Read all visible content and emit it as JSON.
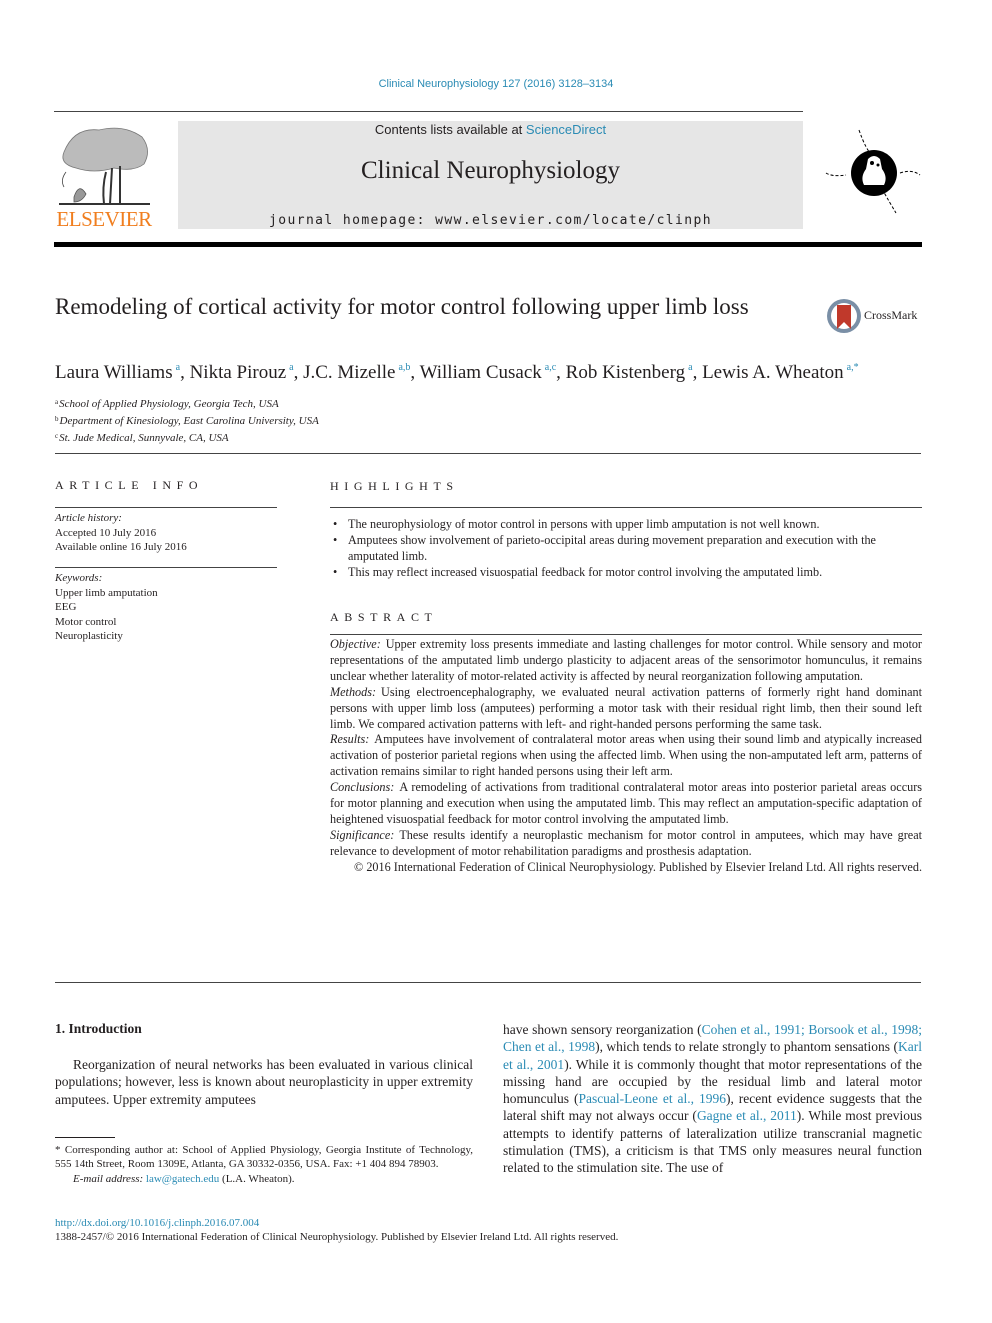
{
  "header": {
    "journal_citation": "Clinical Neurophysiology 127 (2016) 3128–3134",
    "contents_prefix": "Contents lists available at ",
    "contents_link": "ScienceDirect",
    "journal_name": "Clinical Neurophysiology",
    "homepage_prefix": "journal homepage: ",
    "homepage_url": "www.elsevier.com/locate/clinph",
    "publisher_logo_text": "ELSEVIER",
    "publisher_color": "#f07e1f",
    "link_color": "#2a8bb4"
  },
  "article": {
    "title": "Remodeling of cortical activity for motor control following upper limb loss",
    "crossmark_label": "CrossMark",
    "authors": [
      {
        "name": "Laura Williams",
        "affil": "a"
      },
      {
        "name": "Nikta Pirouz",
        "affil": "a"
      },
      {
        "name": "J.C. Mizelle",
        "affil": "a,b"
      },
      {
        "name": "William Cusack",
        "affil": "a,c"
      },
      {
        "name": "Rob Kistenberg",
        "affil": "a"
      },
      {
        "name": "Lewis A. Wheaton",
        "affil": "a,*"
      }
    ],
    "affiliations": [
      {
        "key": "a",
        "text": "School of Applied Physiology, Georgia Tech, USA"
      },
      {
        "key": "b",
        "text": "Department of Kinesiology, East Carolina University, USA"
      },
      {
        "key": "c",
        "text": "St. Jude Medical, Sunnyvale, CA, USA"
      }
    ]
  },
  "article_info": {
    "heading": "ARTICLE INFO",
    "history_label": "Article history:",
    "accepted": "Accepted 10 July 2016",
    "available_online": "Available online 16 July 2016",
    "keywords_label": "Keywords:",
    "keywords": [
      "Upper limb amputation",
      "EEG",
      "Motor control",
      "Neuroplasticity"
    ]
  },
  "highlights": {
    "heading": "HIGHLIGHTS",
    "items": [
      "The neurophysiology of motor control in persons with upper limb amputation is not well known.",
      "Amputees show involvement of parieto-occipital areas during movement preparation and execution with the amputated limb.",
      "This may reflect increased visuospatial feedback for motor control involving the amputated limb."
    ]
  },
  "abstract": {
    "heading": "ABSTRACT",
    "sections": [
      {
        "label": "Objective:",
        "text": "Upper extremity loss presents immediate and lasting challenges for motor control. While sensory and motor representations of the amputated limb undergo plasticity to adjacent areas of the sensorimotor homunculus, it remains unclear whether laterality of motor-related activity is affected by neural reorganization following amputation."
      },
      {
        "label": "Methods:",
        "text": "Using electroencephalography, we evaluated neural activation patterns of formerly right hand dominant persons with upper limb loss (amputees) performing a motor task with their residual right limb, then their sound left limb. We compared activation patterns with left- and right-handed persons performing the same task."
      },
      {
        "label": "Results:",
        "text": "Amputees have involvement of contralateral motor areas when using their sound limb and atypically increased activation of posterior parietal regions when using the affected limb. When using the non-amputated left arm, patterns of activation remains similar to right handed persons using their left arm."
      },
      {
        "label": "Conclusions:",
        "text": "A remodeling of activations from traditional contralateral motor areas into posterior parietal areas occurs for motor planning and execution when using the amputated limb. This may reflect an amputation-specific adaptation of heightened visuospatial feedback for motor control involving the amputated limb."
      },
      {
        "label": "Significance:",
        "text": "These results identify a neuroplastic mechanism for motor control in amputees, which may have great relevance to development of motor rehabilitation paradigms and prosthesis adaptation."
      }
    ],
    "copyright": "© 2016 International Federation of Clinical Neurophysiology. Published by Elsevier Ireland Ltd. All rights reserved."
  },
  "body": {
    "intro_heading": "1. Introduction",
    "left_paragraph": "Reorganization of neural networks has been evaluated in various clinical populations; however, less is known about neuroplasticity in upper extremity amputees. Upper extremity amputees",
    "right_segments": [
      {
        "t": "have shown sensory reorganization (",
        "link": false
      },
      {
        "t": "Cohen et al., 1991; Borsook et al., 1998; Chen et al., 1998",
        "link": true
      },
      {
        "t": "), which tends to relate strongly to phantom sensations (",
        "link": false
      },
      {
        "t": "Karl et al., 2001",
        "link": true
      },
      {
        "t": "). While it is commonly thought that motor representations of the missing hand are occupied by the residual limb and lateral motor homunculus (",
        "link": false
      },
      {
        "t": "Pascual-Leone et al., 1996",
        "link": true
      },
      {
        "t": "), recent evidence suggests that the lateral shift may not always occur (",
        "link": false
      },
      {
        "t": "Gagne et al., 2011",
        "link": true
      },
      {
        "t": "). While most previous attempts to identify patterns of lateralization utilize transcranial magnetic stimulation (TMS), a criticism is that TMS only measures neural function related to the stimulation site. The use of",
        "link": false
      }
    ]
  },
  "footnotes": {
    "corresponding": "* Corresponding author at: School of Applied Physiology, Georgia Institute of Technology, 555 14th Street, Room 1309E, Atlanta, GA 30332-0356, USA. Fax: +1 404 894 78903.",
    "email_label": "E-mail address:",
    "email": "law@gatech.edu",
    "email_suffix": " (L.A. Wheaton).",
    "doi": "http://dx.doi.org/10.1016/j.clinph.2016.07.004",
    "issn_line": "1388-2457/© 2016 International Federation of Clinical Neurophysiology. Published by Elsevier Ireland Ltd. All rights reserved."
  }
}
